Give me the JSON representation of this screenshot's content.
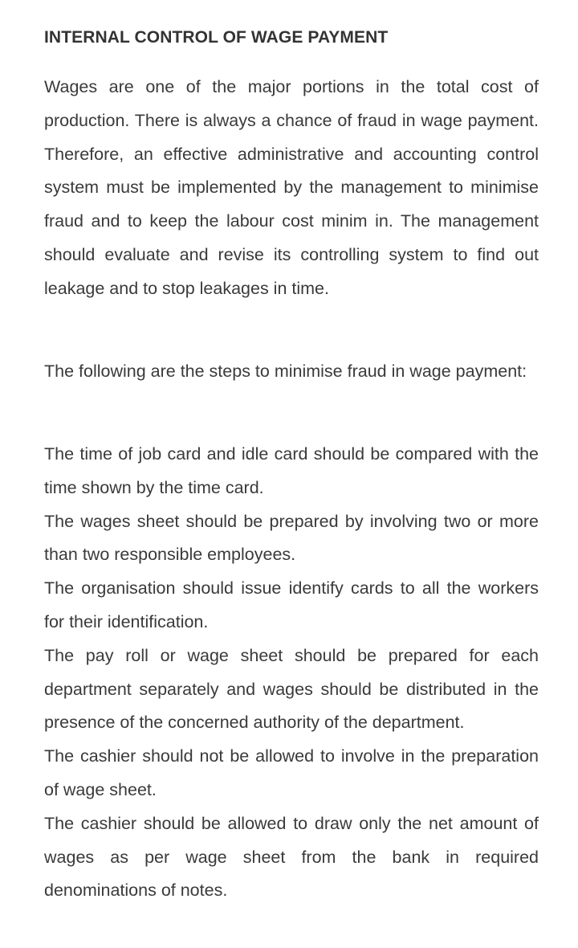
{
  "document": {
    "title": "INTERNAL CONTROL OF WAGE PAYMENT",
    "intro": "Wages are one of the major portions in the total cost of production. There is always a chance of fraud in wage payment. Therefore, an effective administrative and accounting control system must be implemented by the management to minimise fraud and to keep the labour cost minim in. The management should evaluate and revise its controlling system to find out leakage and to stop leakages in time.",
    "lead": "The following are the steps to minimise fraud in wage payment:",
    "steps": [
      "The time of job card and idle card should be compared with the time shown by the time card.",
      "The wages sheet should be prepared by involving two or more than two responsible employees.",
      "The organisation should issue identify cards to all the workers for their identification.",
      "The pay roll or wage sheet should be prepared for each department separately and wages should be distributed in the presence of the concerned authority of the department.",
      "The cashier should not be allowed to involve in the preparation of wage sheet.",
      "The cashier should be allowed to draw only the net amount of wages as per wage sheet from the bank in required denominations of notes."
    ]
  }
}
